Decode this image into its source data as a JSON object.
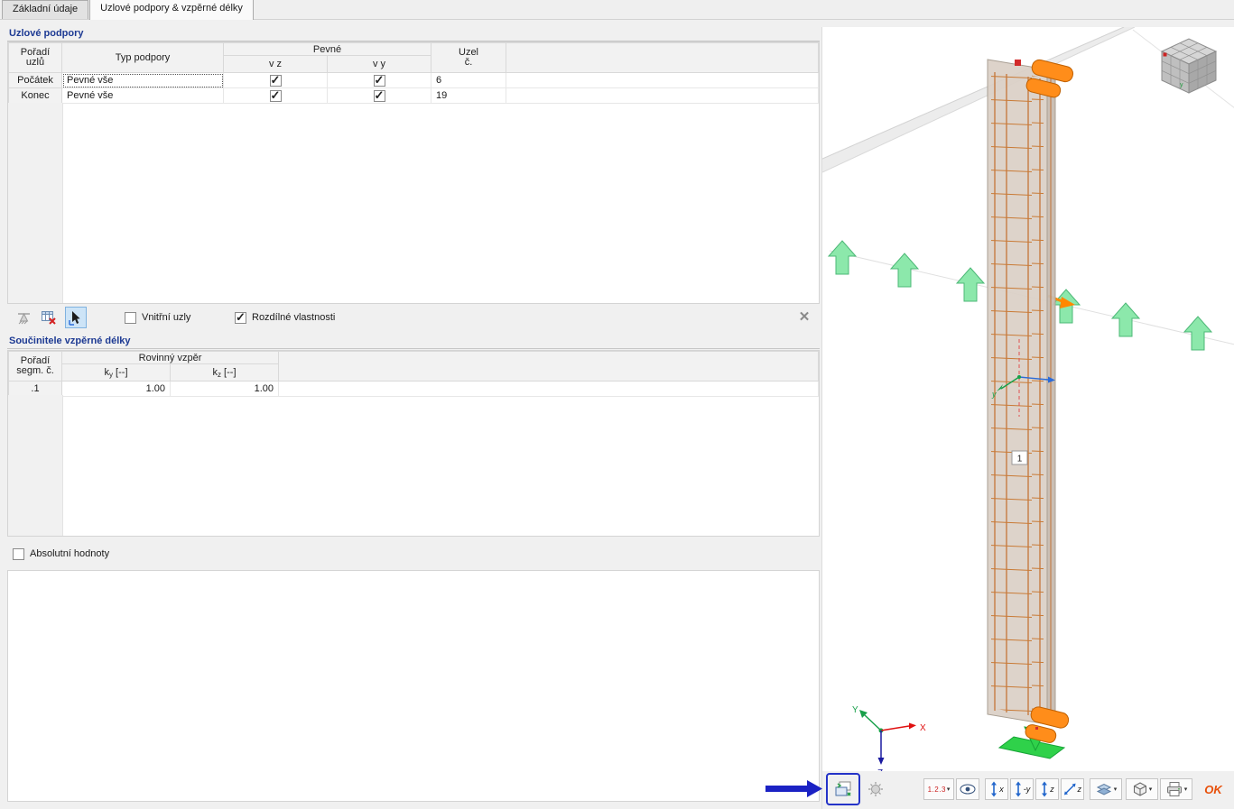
{
  "window": {
    "tabs": [
      {
        "label": "Základní údaje"
      },
      {
        "label": "Uzlové podpory & vzpěrné délky"
      }
    ]
  },
  "supports_section": {
    "title": "Uzlové podpory",
    "table": {
      "col_order": "Pořadí\nuzlů",
      "col_type": "Typ podpory",
      "group_fixed": "Pevné",
      "col_vz": "v z",
      "col_vy": "v y",
      "col_node": "Uzel\nč.",
      "rows": [
        {
          "order": "Počátek",
          "type": "Pevné vše",
          "vz": true,
          "vy": true,
          "node": "6"
        },
        {
          "order": "Konec",
          "type": "Pevné vše",
          "vz": true,
          "vy": true,
          "node": "19"
        }
      ]
    },
    "toolbar": {
      "internal_nodes_label": "Vnitřní uzly",
      "internal_nodes_checked": false,
      "different_props_label": "Rozdílné vlastnosti",
      "different_props_checked": true
    }
  },
  "buckling_section": {
    "title": "Součinitele vzpěrné délky",
    "table": {
      "col_order": "Pořadí\nsegm. č.",
      "group_planar": "Rovinný vzpěr",
      "ky": {
        "base": "k",
        "sub": "y",
        "unit": " [--]"
      },
      "kz": {
        "base": "k",
        "sub": "z",
        "unit": " [--]"
      },
      "rows": [
        {
          "segment": ".1",
          "ky": "1.00",
          "kz": "1.00"
        }
      ]
    },
    "absolute_values_label": "Absolutní hodnoty",
    "absolute_values_checked": false
  },
  "viewport": {
    "member_label": "1",
    "axis_x": "X",
    "axis_y": "Y",
    "axis_z": "Z",
    "local_axis_y": "y",
    "cube_axis": "y"
  },
  "bottom_toolbar": {
    "numbering_label": "1.2.3",
    "view_x": "x",
    "view_minus_y": "-y",
    "view_z": "z",
    "view_minus_z": "z",
    "ok_label": "OK"
  },
  "colors": {
    "accent_blue": "#2433c8",
    "section_title_blue": "#1d3a93",
    "support_orange": "#ff8d1a",
    "line_support_green": "#8ce8ab",
    "base_support_green": "#2fd14a"
  }
}
